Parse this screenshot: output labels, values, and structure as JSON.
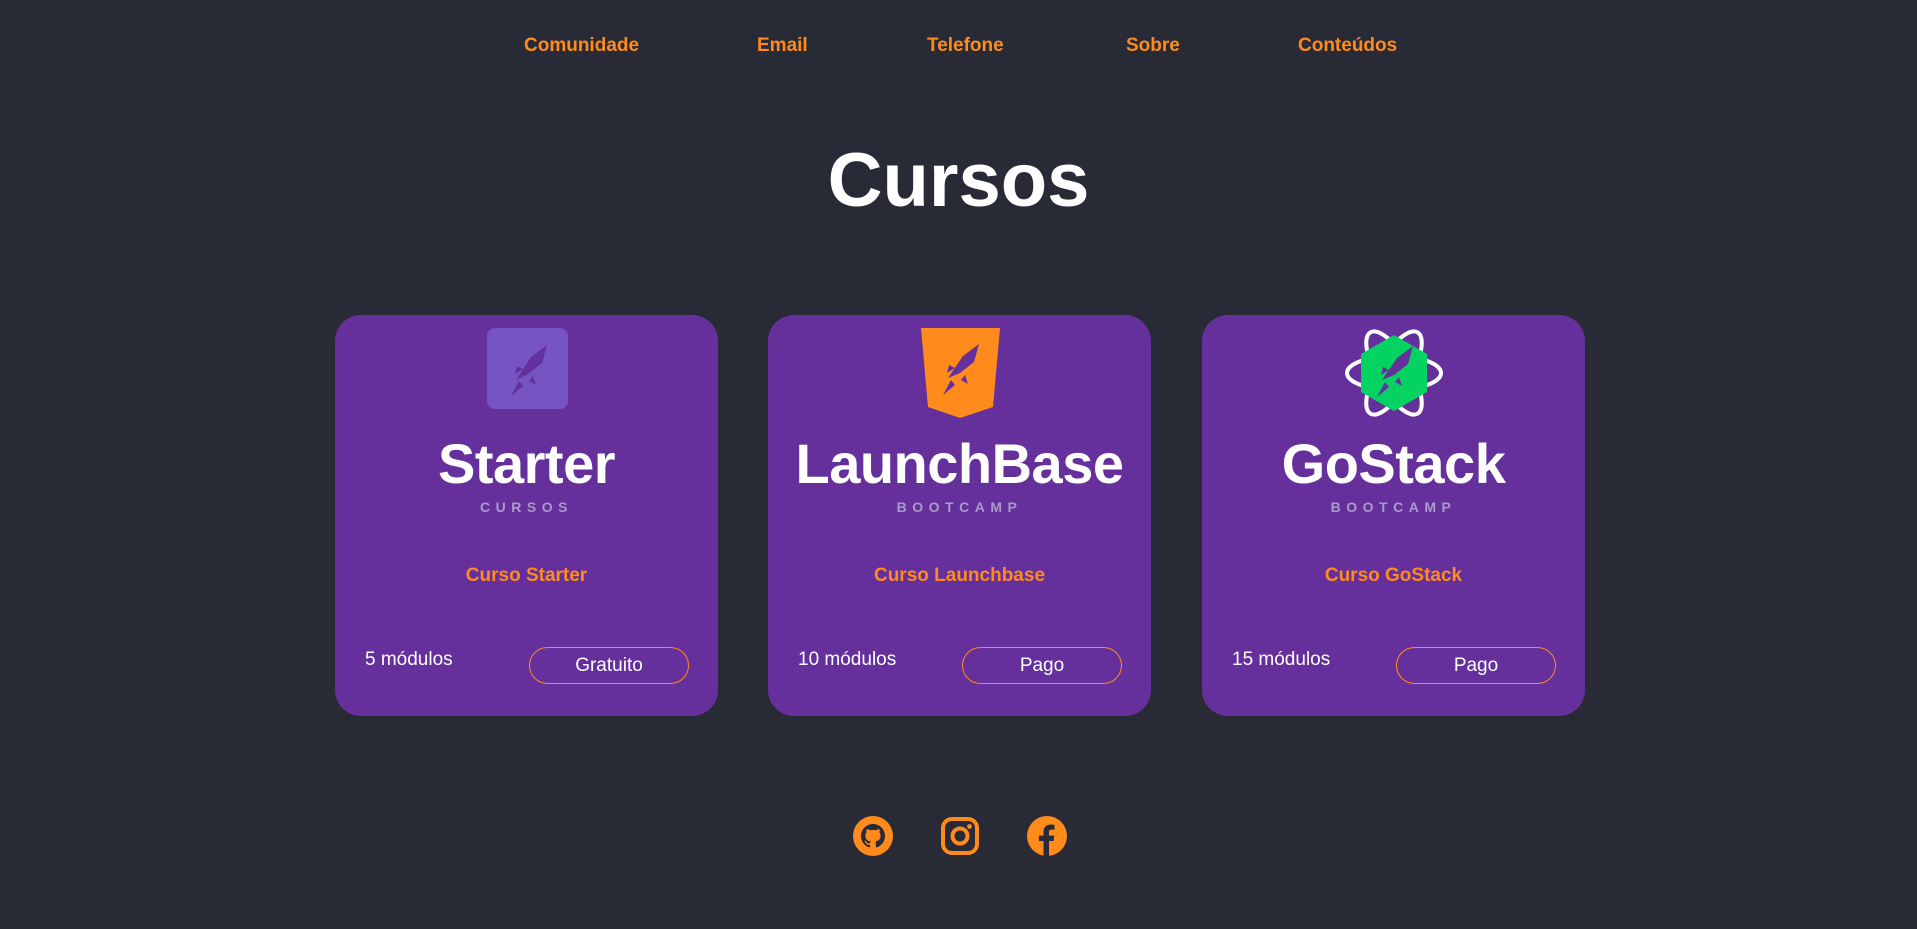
{
  "nav": {
    "items": [
      "Comunidade",
      "Email",
      "Telefone",
      "Sobre",
      "Conteúdos"
    ]
  },
  "page": {
    "title": "Cursos"
  },
  "cards": [
    {
      "name": "Starter",
      "subtitle": "CURSOS",
      "course": "Curso Starter",
      "modules": "5 módulos",
      "price": "Gratuito",
      "icon": "starter-logo-icon",
      "icon_color": "#7654c2"
    },
    {
      "name": "LaunchBase",
      "subtitle": "BOOTCAMP",
      "course": "Curso Launchbase",
      "modules": "10 módulos",
      "price": "Pago",
      "icon": "html5-shield-logo-icon",
      "icon_color": "#ff8b1c"
    },
    {
      "name": "GoStack",
      "subtitle": "BOOTCAMP",
      "course": "Curso GoStack",
      "modules": "15 módulos",
      "price": "Pago",
      "icon": "react-node-logo-icon",
      "icon_color": "#04d361"
    }
  ],
  "footer": {
    "social": [
      "github-icon",
      "instagram-icon",
      "facebook-icon"
    ]
  },
  "colors": {
    "background": "#282a35",
    "card": "#65309c",
    "accent": "#ff8b1c",
    "text": "#ffffff"
  }
}
